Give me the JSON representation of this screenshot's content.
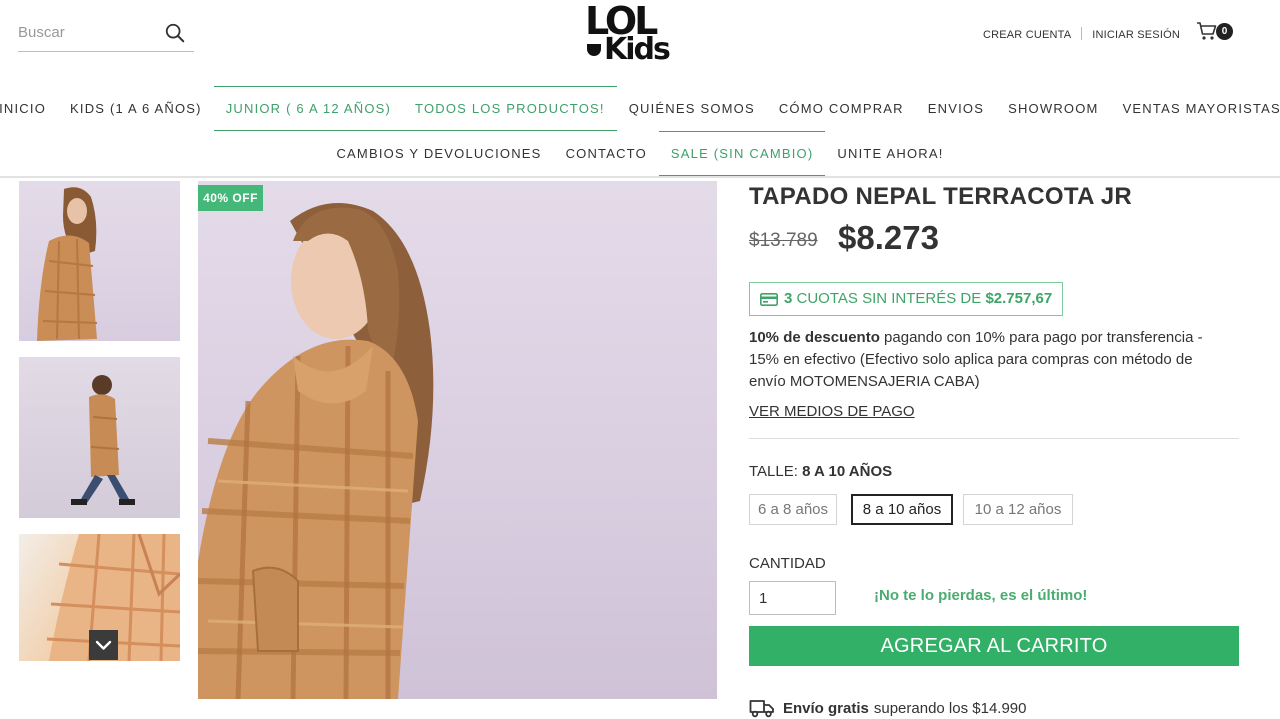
{
  "header": {
    "search": {
      "placeholder": "Buscar",
      "value": ""
    },
    "logo": {
      "line1": "LOL",
      "line2": "Kids"
    },
    "account": {
      "create": "CREAR CUENTA",
      "login": "INICIAR SESIÓN"
    },
    "cart": {
      "count": "0"
    }
  },
  "nav": {
    "row1": [
      {
        "label": "INICIO"
      },
      {
        "label": "KIDS (1 A 6 AÑOS)"
      },
      {
        "label": "JUNIOR ( 6 A 12 AÑOS)"
      },
      {
        "label": "TODOS LOS PRODUCTOS!"
      },
      {
        "label": "QUIÉNES SOMOS"
      },
      {
        "label": "CÓMO COMPRAR"
      },
      {
        "label": "ENVIOS"
      },
      {
        "label": "SHOWROOM"
      },
      {
        "label": "VENTAS MAYORISTAS"
      }
    ],
    "row2": [
      {
        "label": "CAMBIOS Y DEVOLUCIONES"
      },
      {
        "label": "CONTACTO"
      },
      {
        "label": "SALE (SIN CAMBIO)"
      },
      {
        "label": "UNITE AHORA!"
      }
    ]
  },
  "gallery": {
    "badge": "40% OFF"
  },
  "product": {
    "title": "TAPADO NEPAL TERRACOTA JR",
    "price_old": "$13.789",
    "price_new": "$8.273",
    "installments": {
      "count": "3",
      "text": " CUOTAS SIN INTERÉS DE ",
      "amount": "$2.757,67"
    },
    "discount": {
      "bold": "10% de descuento",
      "text": " pagando con 10% para pago por transferencia - 15% en efectivo (Efectivo solo aplica para compras con método de envío MOTOMENSAJERIA CABA)"
    },
    "payment_link": "VER MEDIOS DE PAGO",
    "size": {
      "label": "TALLE: ",
      "selected": "8 A 10 AÑOS",
      "options": [
        "6 a 8 años",
        "8 a 10 años",
        "10 a 12 años"
      ]
    },
    "quantity": {
      "label": "CANTIDAD",
      "value": "1"
    },
    "stock_note": "¡No te lo pierdas, es el último!",
    "add_to_cart": "AGREGAR AL CARRITO",
    "shipping": {
      "bold": "Envío gratis",
      "text": "superando los $14.990"
    }
  },
  "colors": {
    "accent": "#32b067",
    "badge": "#44b878",
    "text": "#333333"
  }
}
